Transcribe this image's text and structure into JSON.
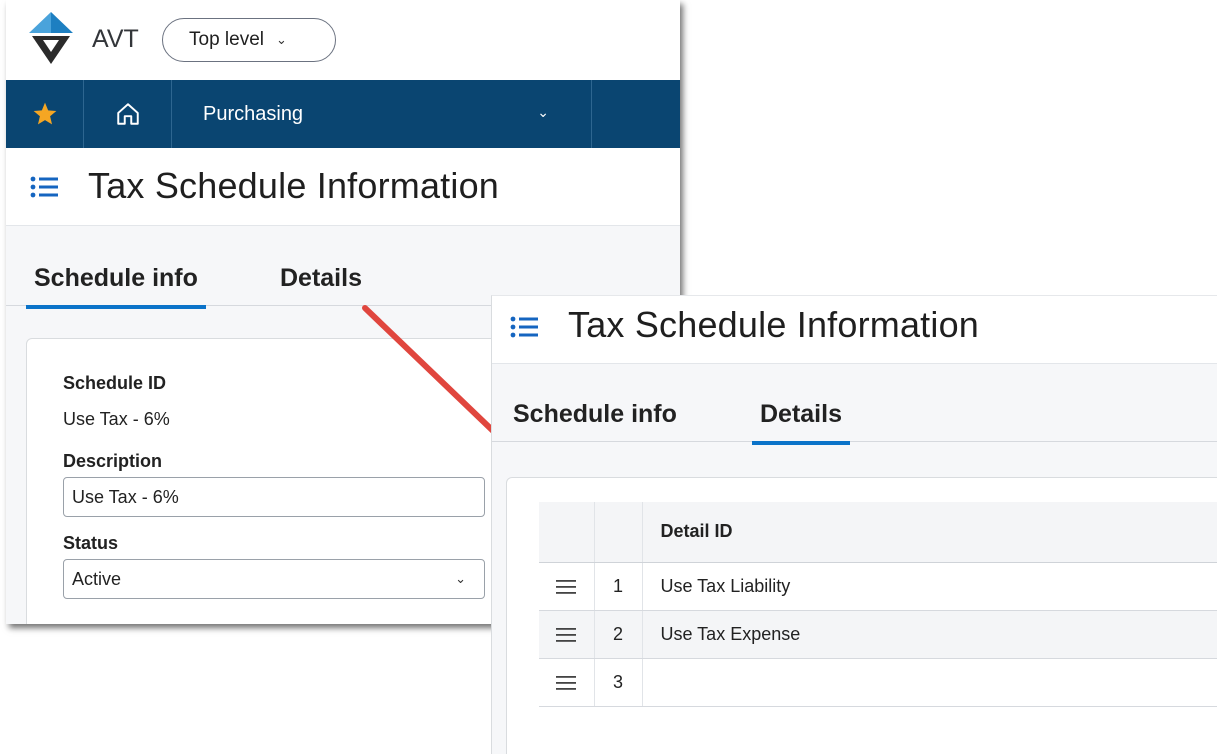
{
  "app": {
    "brand": "AVT",
    "level_label": "Top level",
    "module_label": "Purchasing",
    "nav_colors": {
      "navbar": "#0a4571",
      "star": "#f5a623",
      "tab_underline": "#0b73c9",
      "arrow": "#e0463e"
    }
  },
  "left_window": {
    "page_title": "Tax Schedule Information",
    "tabs": [
      {
        "label": "Schedule info",
        "active": true
      },
      {
        "label": "Details",
        "active": false
      }
    ],
    "form": {
      "schedule_id_label": "Schedule ID",
      "schedule_id_value": "Use Tax - 6%",
      "description_label": "Description",
      "description_value": "Use Tax - 6%",
      "status_label": "Status",
      "status_value": "Active"
    }
  },
  "right_window": {
    "page_title": "Tax Schedule Information",
    "tabs": [
      {
        "label": "Schedule info",
        "active": false
      },
      {
        "label": "Details",
        "active": true
      }
    ],
    "grid": {
      "column_header": "Detail ID",
      "rows": [
        {
          "num": "1",
          "detail_id": "Use Tax Liability"
        },
        {
          "num": "2",
          "detail_id": "Use Tax Expense"
        },
        {
          "num": "3",
          "detail_id": ""
        }
      ]
    }
  },
  "icons": {
    "logo": "avt-logo-icon",
    "favorites": "star-icon",
    "home": "home-icon",
    "page_list": "list-icon",
    "row_handle": "drag-handle-icon",
    "dropdown": "chevron-down-icon",
    "callout": "red-arrow"
  }
}
